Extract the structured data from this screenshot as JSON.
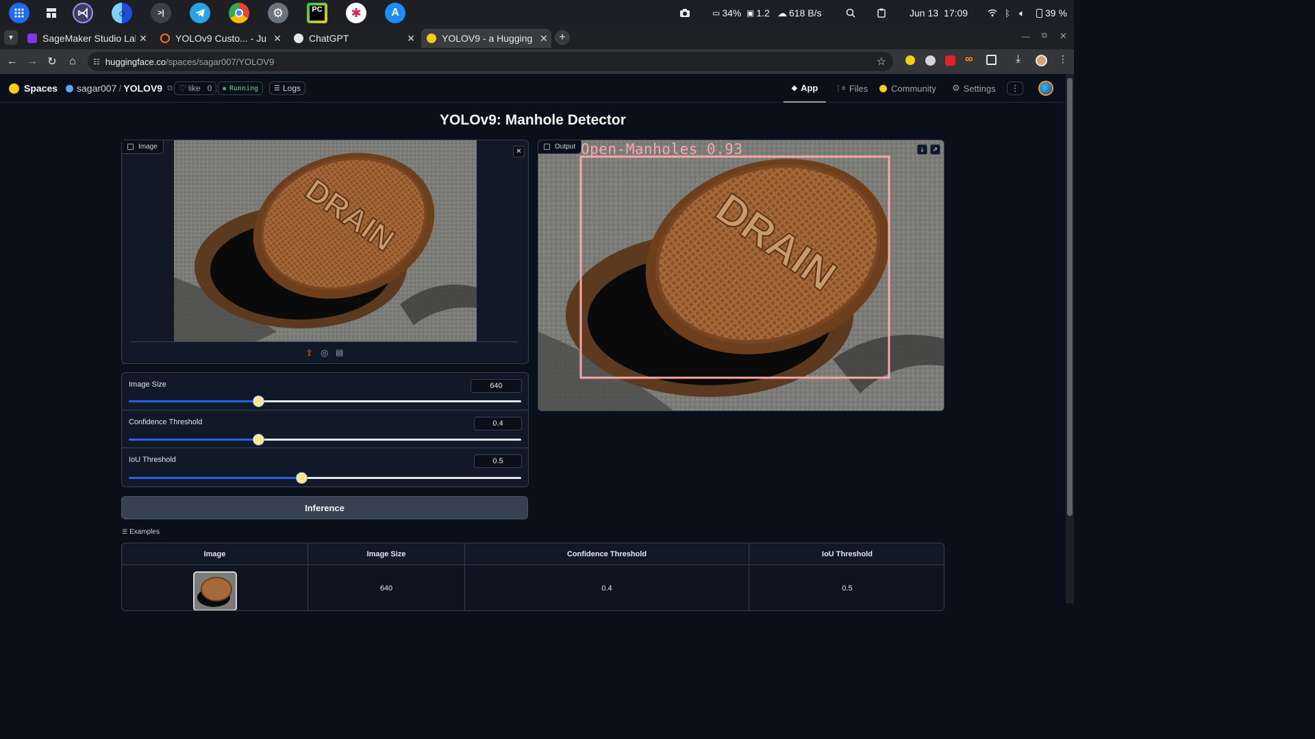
{
  "os_bar": {
    "stats": {
      "cpu": "34%",
      "load": "1.2",
      "net": "618 B/s"
    },
    "date": "Jun 13",
    "time": "17:09",
    "battery": "39 %"
  },
  "browser": {
    "tabs": [
      {
        "title": "SageMaker Studio Lab",
        "fav_color": "#7c3aed"
      },
      {
        "title": "YOLOv9  Custo... - Ju",
        "fav_color": "#f97316"
      },
      {
        "title": "ChatGPT",
        "fav_color": "#e5e7eb"
      },
      {
        "title": "YOLOV9 - a Hugging",
        "fav_color": "#facc15"
      }
    ],
    "url_host": "huggingface.co",
    "url_path": "/spaces/sagar007/YOLOV9"
  },
  "hf_header": {
    "brand": "Spaces",
    "owner": "sagar007",
    "separator": "/",
    "repo": "YOLOV9",
    "like_label": "like",
    "like_count": "0",
    "status": "Running",
    "logs": "Logs",
    "nav": {
      "app": "App",
      "files": "Files",
      "community": "Community",
      "settings": "Settings"
    }
  },
  "app": {
    "title": "YOLOv9: Manhole Detector",
    "input_label": "Image",
    "output_label": "Output",
    "detection": {
      "label": "Open-Manholes 0.93",
      "class": "Open-Manholes",
      "confidence": 0.93
    },
    "sliders": [
      {
        "label": "Image Size",
        "value": "640",
        "fraction": 0.33
      },
      {
        "label": "Confidence Threshold",
        "value": "0.4",
        "fraction": 0.33
      },
      {
        "label": "IoU Threshold",
        "value": "0.5",
        "fraction": 0.44
      }
    ],
    "inference_button": "Inference",
    "examples": {
      "label": "Examples",
      "headers": [
        "Image",
        "Image Size",
        "Confidence Threshold",
        "IoU Threshold"
      ],
      "rows": [
        {
          "image_size": "640",
          "confidence": "0.4",
          "iou": "0.5"
        }
      ]
    }
  },
  "colors": {
    "accent": "#2563eb",
    "running": "#22c55e",
    "detection_box": "#f9a8a8",
    "background": "#0b0f19"
  }
}
